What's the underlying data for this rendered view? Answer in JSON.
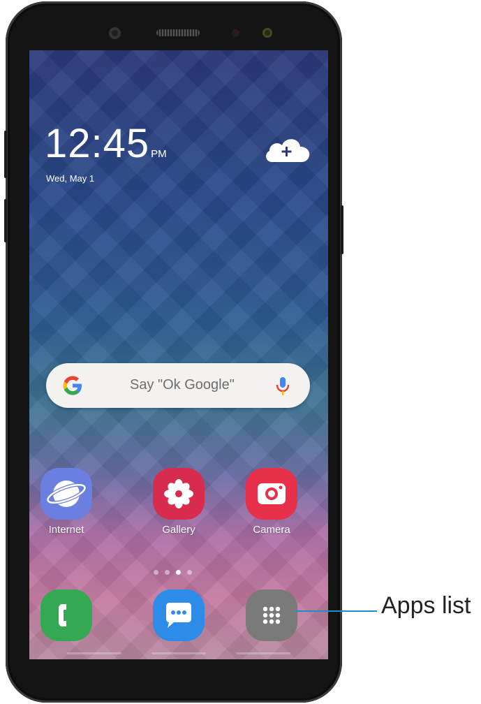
{
  "lockscreen": {
    "time": "12:45",
    "ampm": "PM",
    "date": "Wed, May 1"
  },
  "search": {
    "placeholder": "Say \"Ok Google\""
  },
  "apps": [
    {
      "label": "Internet",
      "icon": "internet-icon",
      "color": "#6a7fe0"
    },
    {
      "label": "Gallery",
      "icon": "gallery-icon",
      "color": "#d82c4c"
    },
    {
      "label": "Camera",
      "icon": "camera-icon",
      "color": "#e8304a"
    }
  ],
  "dock": [
    {
      "icon": "phone-icon",
      "color": "#34a853"
    },
    {
      "icon": "messages-icon",
      "color": "#2d8ce8"
    },
    {
      "icon": "apps-list-icon",
      "color": "#7a7a7a"
    }
  ],
  "callout": {
    "label": "Apps list",
    "color": "#1c8ec9"
  }
}
